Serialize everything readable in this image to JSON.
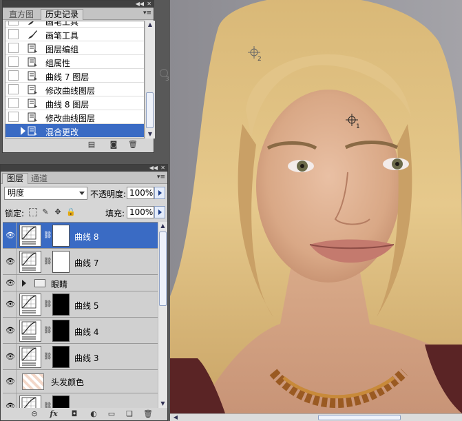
{
  "history_panel": {
    "tabs": [
      {
        "label": "直方图",
        "active": false
      },
      {
        "label": "历史记录",
        "active": true
      }
    ],
    "items": [
      {
        "label": "画笔工具",
        "icon": "brush-icon",
        "partial": true
      },
      {
        "label": "画笔工具",
        "icon": "brush-icon"
      },
      {
        "label": "图层编组",
        "icon": "history-doc-icon"
      },
      {
        "label": "组属性",
        "icon": "history-doc-icon"
      },
      {
        "label": "曲线 7 图层",
        "icon": "history-doc-icon"
      },
      {
        "label": "修改曲线图层",
        "icon": "history-doc-icon"
      },
      {
        "label": "曲线 8 图层",
        "icon": "history-doc-icon"
      },
      {
        "label": "修改曲线图层",
        "icon": "history-doc-icon"
      },
      {
        "label": "混合更改",
        "icon": "history-doc-icon",
        "selected": true
      }
    ],
    "footer_icons": [
      "new-document-icon",
      "camera-snapshot-icon",
      "trash-icon"
    ]
  },
  "layers_panel": {
    "tabs": [
      {
        "label": "图层",
        "active": true
      },
      {
        "label": "通道",
        "active": false
      }
    ],
    "blend_mode": "明度",
    "opacity_label": "不透明度:",
    "opacity_value": "100%",
    "lock_label": "锁定:",
    "fill_label": "填充:",
    "fill_value": "100%",
    "layers": [
      {
        "name": "曲线 8",
        "type": "curves",
        "mask": "white",
        "selected": true
      },
      {
        "name": "曲线 7",
        "type": "curves",
        "mask": "white"
      },
      {
        "name": "眼睛",
        "type": "group"
      },
      {
        "name": "曲线 5",
        "type": "curves",
        "mask": "black"
      },
      {
        "name": "曲线 4",
        "type": "curves",
        "mask": "black"
      },
      {
        "name": "曲线 3",
        "type": "curves",
        "mask": "black"
      },
      {
        "name": "头发颜色",
        "type": "pixel"
      },
      {
        "name": "",
        "type": "curves",
        "mask": "black",
        "partial": true
      }
    ],
    "footer_icons": [
      "link-icon",
      "fx-icon",
      "add-mask-icon",
      "adjustment-layer-icon",
      "new-group-icon",
      "new-layer-icon",
      "trash-icon"
    ],
    "fx_label": "fx"
  },
  "canvas": {
    "sampler_labels": [
      "1",
      "2",
      "3"
    ]
  },
  "colors": {
    "selection": "#3a6bc4",
    "panel_bg": "#d6d6d6",
    "gutter": "#585858"
  }
}
